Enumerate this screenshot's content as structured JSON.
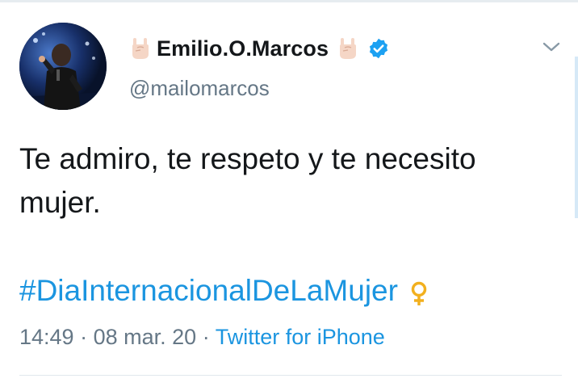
{
  "tweet": {
    "display_name": "Emilio.O.Marcos",
    "handle": "@mailomarcos",
    "body_line1": "Te admiro, te respeto y te necesito",
    "body_line2": "mujer.",
    "hashtag": "#DiaInternacionalDeLaMujer",
    "time": "14:49",
    "date": "08 mar. 20",
    "source": "Twitter for iPhone",
    "separator": "·"
  },
  "icons": {
    "name_prefix": "rock-hand-icon",
    "name_suffix": "rock-hand-icon",
    "verified": "verified-badge-icon",
    "menu": "chevron-down-icon",
    "hashtag_emoji": "female-sign-icon"
  },
  "colors": {
    "text": "#14171a",
    "muted": "#657786",
    "link": "#1b95e0",
    "verified": "#1da1f2",
    "emoji_gold": "#f2b01e"
  }
}
